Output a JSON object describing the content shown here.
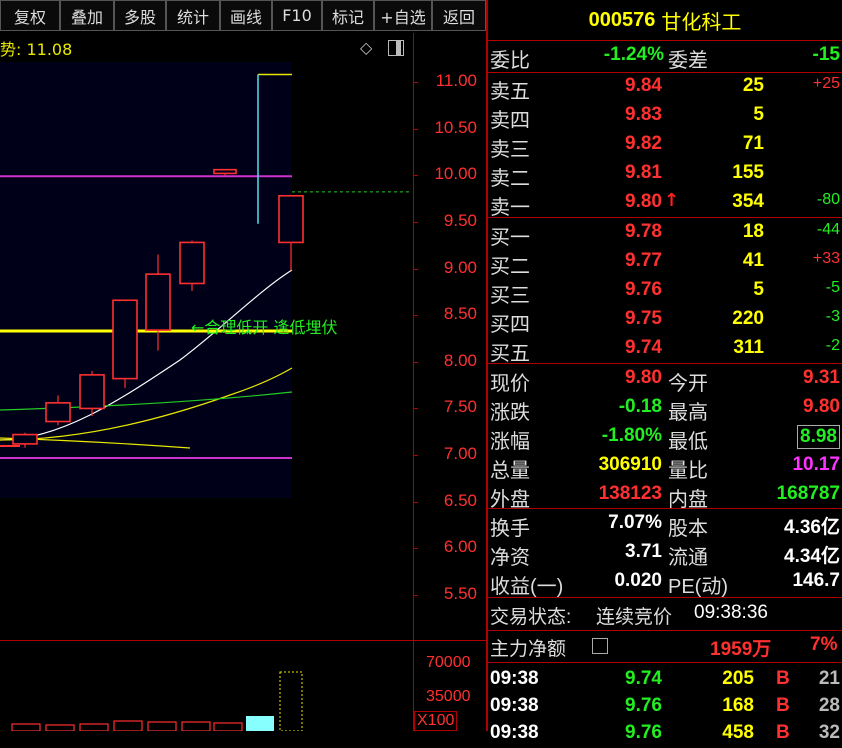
{
  "toolbar": {
    "buttons": [
      "复权",
      "叠加",
      "多股",
      "统计",
      "画线",
      "F10",
      "标记",
      "+自选",
      "返回"
    ]
  },
  "chart": {
    "title": "势: 11.08",
    "annotation": "←合理低开 逢低埋伏",
    "y_ticks": [
      "11.00",
      "10.50",
      "10.00",
      "9.50",
      "9.00",
      "8.50",
      "8.00",
      "7.50",
      "7.00",
      "6.50",
      "6.00",
      "5.50"
    ],
    "vol_ticks": [
      "70000",
      "35000"
    ],
    "vol_unit": "X100"
  },
  "chart_data": {
    "type": "candlestick",
    "ylim": [
      5.2,
      11.3
    ],
    "candles": [
      {
        "open": 7.12,
        "close": 7.22,
        "high": 7.24,
        "low": 7.08
      },
      {
        "open": 7.36,
        "close": 7.56,
        "high": 7.64,
        "low": 7.32
      },
      {
        "open": 7.5,
        "close": 7.86,
        "high": 7.9,
        "low": 7.42
      },
      {
        "open": 7.82,
        "close": 8.66,
        "high": 8.66,
        "low": 7.72
      },
      {
        "open": 8.34,
        "close": 8.94,
        "high": 9.15,
        "low": 8.12
      },
      {
        "open": 8.84,
        "close": 9.28,
        "high": 9.3,
        "low": 8.76
      },
      {
        "open": 10.02,
        "close": 10.06,
        "high": 10.06,
        "low": 10.0
      },
      {
        "open": 9.78,
        "close": 9.28,
        "high": 9.78,
        "low": 8.98
      }
    ],
    "last_price": 9.8,
    "pressure_line": 9.99,
    "support_line": 8.33,
    "high_marker": 11.08
  },
  "stock": {
    "code": "000576",
    "name": "甘化科工"
  },
  "weibi": {
    "label": "委比",
    "value": "-1.24%",
    "diff_label": "委差",
    "diff_value": "-15"
  },
  "asks": [
    {
      "label": "卖五",
      "price": "9.84",
      "vol": "25",
      "chg": "+25",
      "chg_color": "red"
    },
    {
      "label": "卖四",
      "price": "9.83",
      "vol": "5",
      "chg": "",
      "chg_color": "red"
    },
    {
      "label": "卖三",
      "price": "9.82",
      "vol": "71",
      "chg": "",
      "chg_color": "red"
    },
    {
      "label": "卖二",
      "price": "9.81",
      "vol": "155",
      "chg": "",
      "chg_color": "red"
    },
    {
      "label": "卖一",
      "price": "9.80",
      "vol": "354",
      "chg": "-80",
      "chg_color": "green"
    }
  ],
  "bids": [
    {
      "label": "买一",
      "price": "9.78",
      "vol": "18",
      "chg": "-44",
      "chg_color": "green"
    },
    {
      "label": "买二",
      "price": "9.77",
      "vol": "41",
      "chg": "+33",
      "chg_color": "red"
    },
    {
      "label": "买三",
      "price": "9.76",
      "vol": "5",
      "chg": "-5",
      "chg_color": "green"
    },
    {
      "label": "买四",
      "price": "9.75",
      "vol": "220",
      "chg": "-3",
      "chg_color": "green"
    },
    {
      "label": "买五",
      "price": "9.74",
      "vol": "311",
      "chg": "-2",
      "chg_color": "green"
    }
  ],
  "quote": [
    {
      "l1": "现价",
      "v1": "9.80",
      "c1": "red",
      "l2": "今开",
      "v2": "9.31",
      "c2": "red"
    },
    {
      "l1": "涨跌",
      "v1": "-0.18",
      "c1": "green",
      "l2": "最高",
      "v2": "9.80",
      "c2": "red"
    },
    {
      "l1": "涨幅",
      "v1": "-1.80%",
      "c1": "green",
      "l2": "最低",
      "v2": "8.98",
      "c2": "green"
    },
    {
      "l1": "总量",
      "v1": "306910",
      "c1": "yellow",
      "l2": "量比",
      "v2": "10.17",
      "c2": "magenta"
    },
    {
      "l1": "外盘",
      "v1": "138123",
      "c1": "red",
      "l2": "内盘",
      "v2": "168787",
      "c2": "green"
    }
  ],
  "fundamentals": [
    {
      "l1": "换手",
      "v1": "7.07%",
      "l2": "股本",
      "v2": "4.36亿"
    },
    {
      "l1": "净资",
      "v1": "3.71",
      "l2": "流通",
      "v2": "4.34亿"
    },
    {
      "l1": "收益(一)",
      "v1": "0.020",
      "l2": "PE(动)",
      "v2": "146.7"
    }
  ],
  "trade_status": {
    "label": "交易状态:",
    "value": "连续竞价",
    "time": "09:38:36"
  },
  "main_flow": {
    "label": "主力净额",
    "value": "1959万",
    "pct": "7%"
  },
  "ticks": [
    {
      "time": "09:38",
      "price": "9.74",
      "vol": "205",
      "side": "B",
      "num": "21"
    },
    {
      "time": "09:38",
      "price": "9.76",
      "vol": "168",
      "side": "B",
      "num": "28"
    },
    {
      "time": "09:38",
      "price": "9.76",
      "vol": "458",
      "side": "B",
      "num": "32"
    }
  ]
}
